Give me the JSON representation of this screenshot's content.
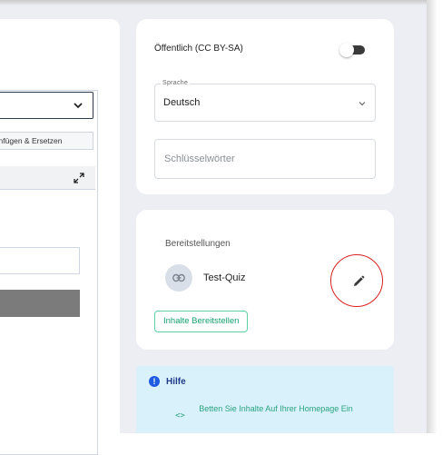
{
  "editor": {
    "replace_button_label": "Einfügen & Ersetzen"
  },
  "settings": {
    "public_label": "Öffentlich (CC BY-SA)",
    "public_toggle_on": false,
    "language": {
      "legend": "Sprache",
      "value": "Deutsch"
    },
    "keywords": {
      "placeholder": "Schlüsselwörter",
      "value": ""
    }
  },
  "deployments": {
    "title": "Bereitstellungen",
    "items": [
      {
        "name": "Test-Quiz",
        "icon": "link-icon",
        "action_icon": "pencil-edit-icon"
      }
    ],
    "deploy_button_label": "Inhalte Bereitstellen"
  },
  "help": {
    "title": "Hilfe",
    "icon": "info-icon",
    "embed_icon_glyph": "<>",
    "embed_link": "Betten Sie Inhalte Auf Ihrer Homepage Ein"
  },
  "colors": {
    "page_bg": "#eceef3",
    "accent_green": "#17a06e",
    "highlight_red": "#d82020",
    "help_bg": "#d9f1fb",
    "help_title": "#1f3a8a"
  }
}
